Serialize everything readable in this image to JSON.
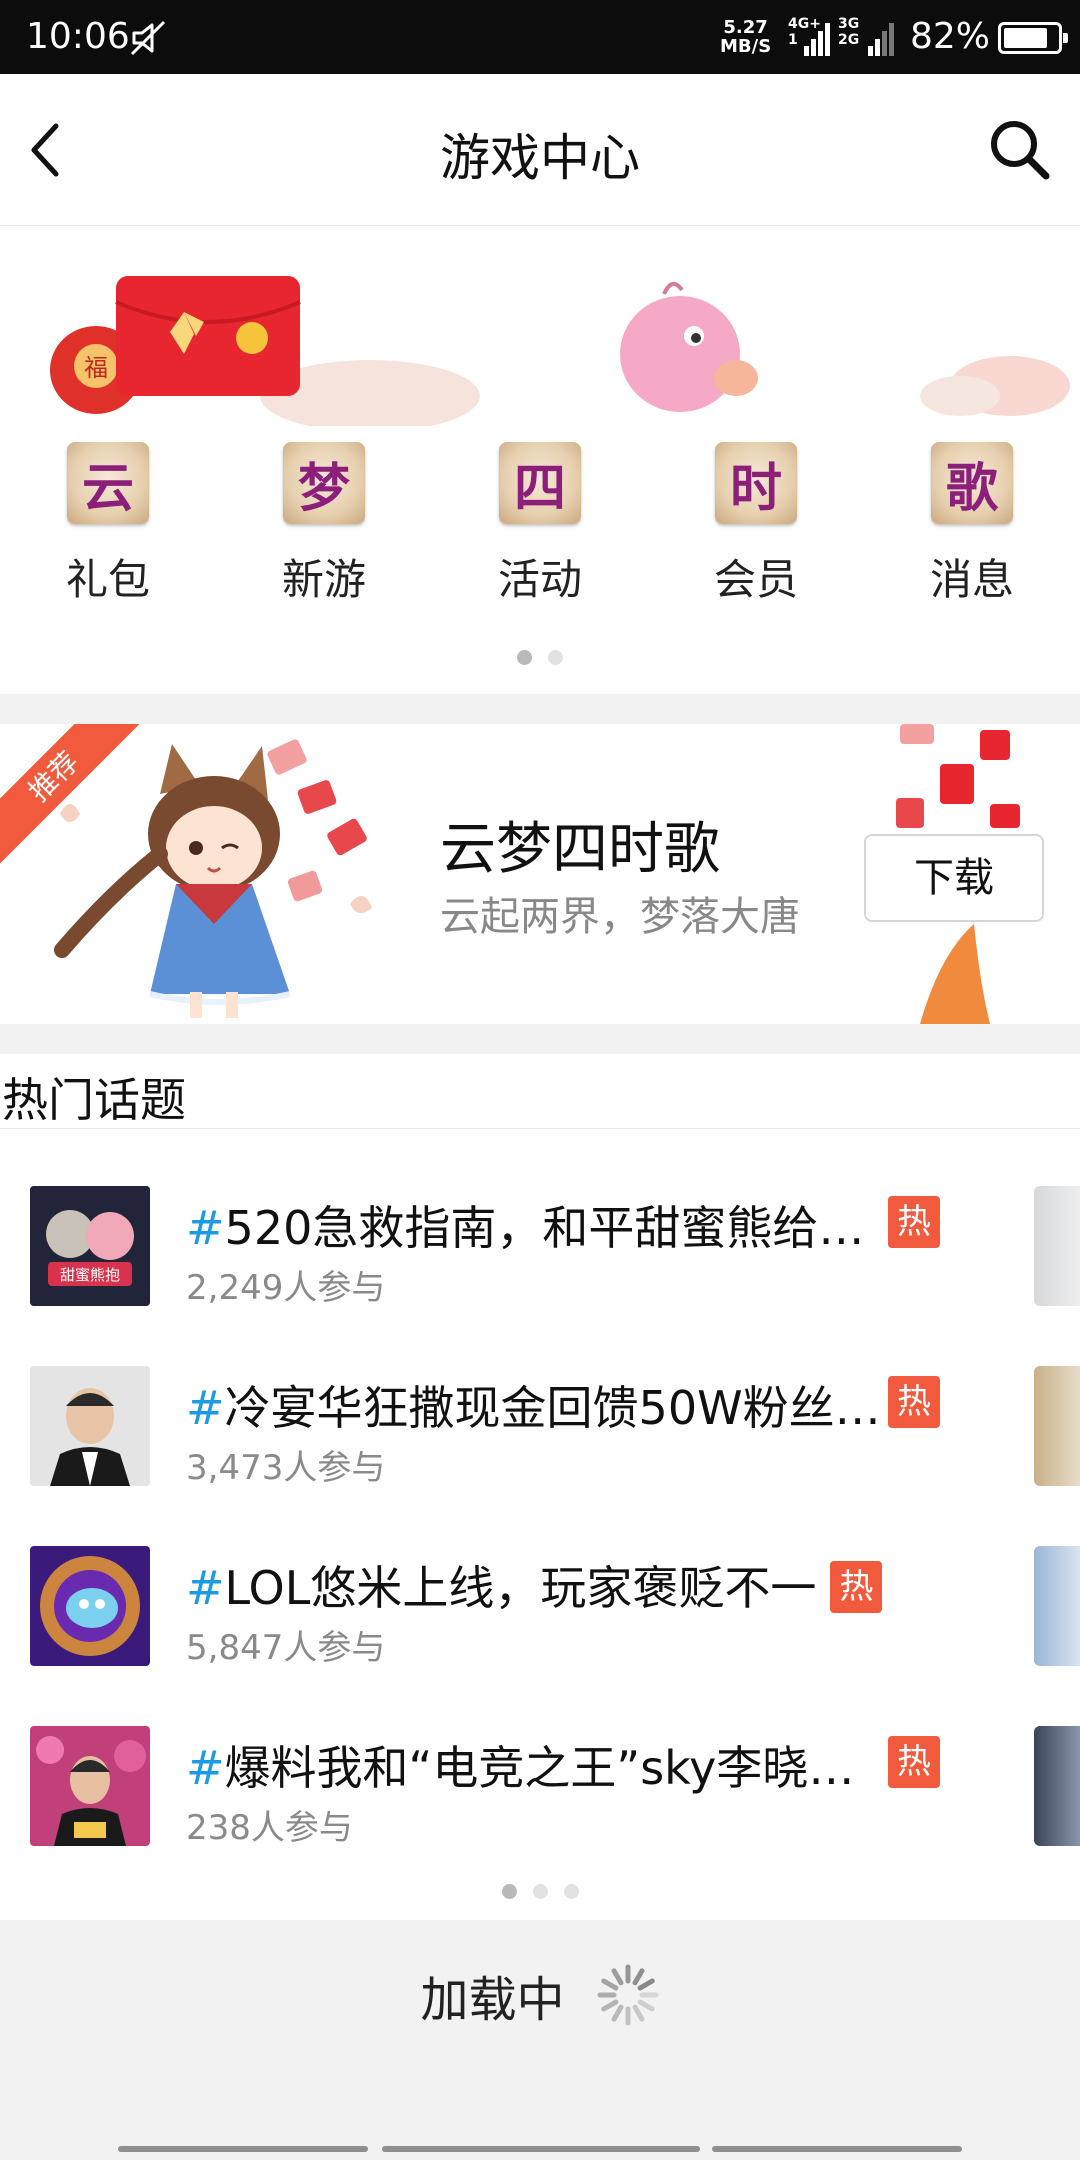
{
  "status_bar": {
    "time": "10:06",
    "speed_value": "5.27",
    "speed_unit": "MB/S",
    "net_a_top": "4G+",
    "net_a_bottom": "1",
    "net_b_top": "3G",
    "net_b_bottom": "2G",
    "battery_percent": "82%",
    "battery_level": 0.82
  },
  "nav": {
    "title": "游戏中心"
  },
  "grid": {
    "items": [
      {
        "glyph": "云",
        "label": "礼包"
      },
      {
        "glyph": "梦",
        "label": "新游"
      },
      {
        "glyph": "四",
        "label": "活动"
      },
      {
        "glyph": "时",
        "label": "会员"
      },
      {
        "glyph": "歌",
        "label": "消息"
      }
    ],
    "page_count": 2,
    "active_page": 0
  },
  "recommend": {
    "ribbon": "推荐",
    "game_name": "云梦四时歌",
    "game_desc": "云起两界，梦落大唐",
    "download_label": "下载"
  },
  "hot_topics": {
    "title": "热门话题",
    "hash": "#",
    "hot_badge": "热",
    "thumb_text_0": "甜蜜熊抱",
    "items": [
      {
        "title": "520急救指南，和平甜蜜熊给…",
        "participants": "2,249人参与"
      },
      {
        "title": "冷宴华狂撒现金回馈50W粉丝…",
        "participants": "3,473人参与"
      },
      {
        "title": "LOL悠米上线，玩家褒贬不一",
        "participants": "5,847人参与"
      },
      {
        "title": "爆料我和“电竞之王”sky李晓…",
        "participants": "238人参与"
      }
    ],
    "page_count": 3,
    "active_page": 0
  },
  "loading": {
    "text": "加载中"
  },
  "colors": {
    "accent_hot": "#f25a3d",
    "hash_blue": "#1b9ae6"
  }
}
